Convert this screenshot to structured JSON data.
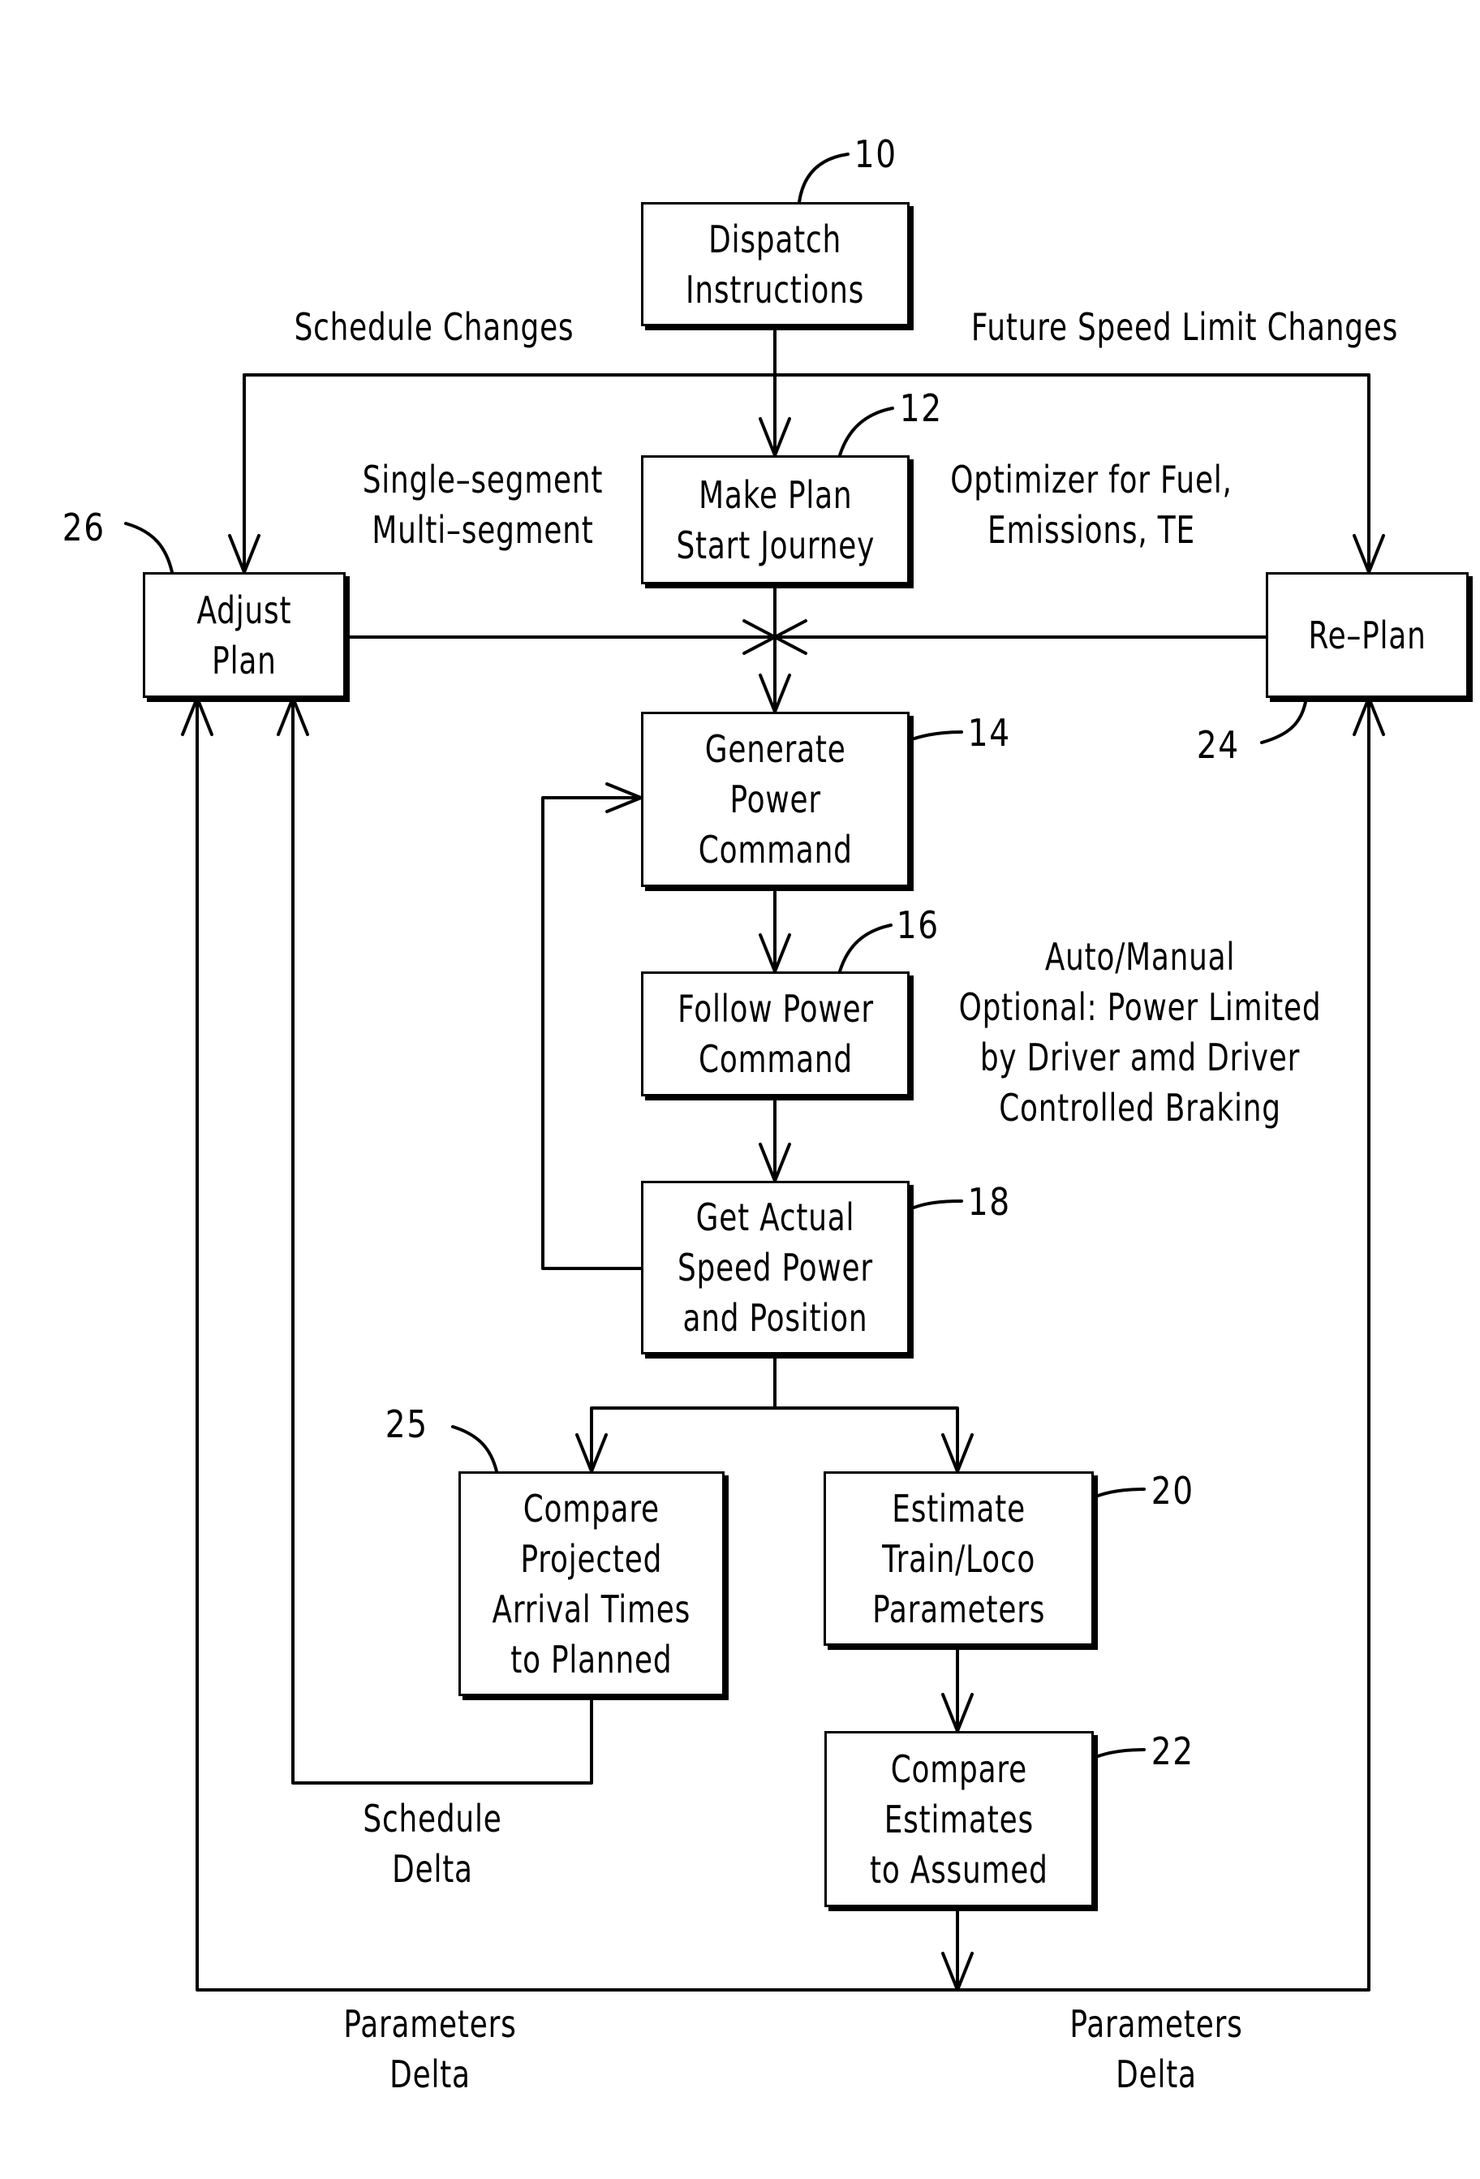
{
  "figure": {
    "nodes": [
      {
        "id": "10",
        "ref": "10",
        "text": "Dispatch\nInstructions"
      },
      {
        "id": "12",
        "ref": "12",
        "text": "Make Plan\nStart Journey"
      },
      {
        "id": "26",
        "ref": "26",
        "text": "Adjust\nPlan"
      },
      {
        "id": "24",
        "ref": "24",
        "text": "Re–Plan"
      },
      {
        "id": "14",
        "ref": "14",
        "text": "Generate\nPower\nCommand"
      },
      {
        "id": "16",
        "ref": "16",
        "text": "Follow Power\nCommand"
      },
      {
        "id": "18",
        "ref": "18",
        "text": "Get Actual\nSpeed Power\nand Position"
      },
      {
        "id": "25",
        "ref": "25",
        "text": "Compare\nProjected\nArrival Times\nto Planned"
      },
      {
        "id": "20",
        "ref": "20",
        "text": "Estimate\nTrain/Loco\nParameters"
      },
      {
        "id": "22",
        "ref": "22",
        "text": "Compare\nEstimates\nto Assumed"
      }
    ],
    "annotations": {
      "schedule_changes": "Schedule Changes",
      "future_speed_limit_changes": "Future Speed Limit Changes",
      "segment_modes": "Single–segment\nMulti–segment",
      "optimizer": "Optimizer for Fuel,\nEmissions, TE",
      "auto_manual": "Auto/Manual\nOptional: Power Limited\nby Driver amd Driver\nControlled Braking",
      "schedule_delta": "Schedule\nDelta",
      "parameters_delta_left": "Parameters\nDelta",
      "parameters_delta_right": "Parameters\nDelta"
    },
    "edges": [
      {
        "from": "10",
        "to": "12"
      },
      {
        "from": "10",
        "to": "26",
        "label": "Schedule Changes"
      },
      {
        "from": "10",
        "to": "24",
        "label": "Future Speed Limit Changes"
      },
      {
        "from": "12",
        "to": "14"
      },
      {
        "from": "26",
        "to": "14"
      },
      {
        "from": "24",
        "to": "14"
      },
      {
        "from": "14",
        "to": "16"
      },
      {
        "from": "16",
        "to": "18"
      },
      {
        "from": "18",
        "to": "14"
      },
      {
        "from": "18",
        "to": "25"
      },
      {
        "from": "18",
        "to": "20"
      },
      {
        "from": "20",
        "to": "22"
      },
      {
        "from": "25",
        "to": "26",
        "label": "Schedule Delta"
      },
      {
        "from": "22",
        "to": "26",
        "label": "Parameters Delta"
      },
      {
        "from": "22",
        "to": "24",
        "label": "Parameters Delta"
      }
    ]
  }
}
